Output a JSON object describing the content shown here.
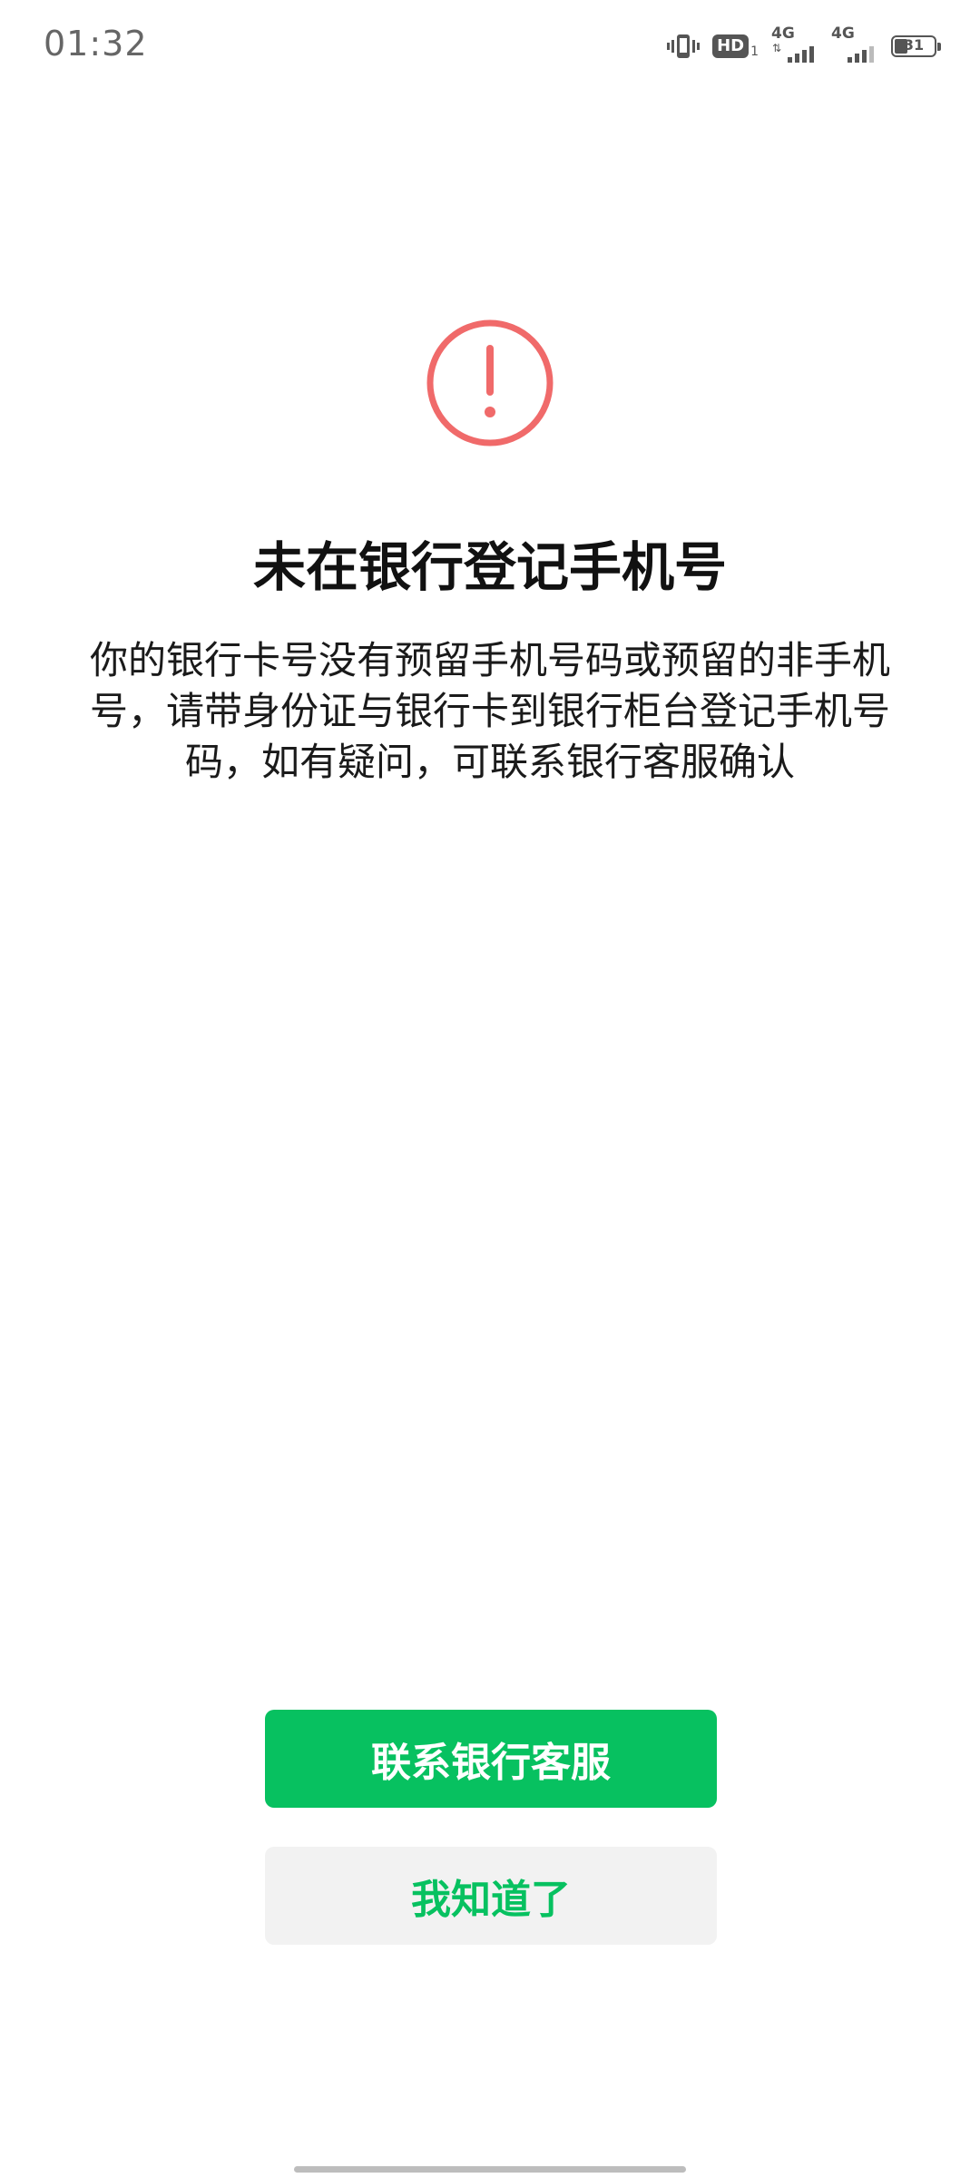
{
  "status_bar": {
    "time": "01:32",
    "hd_label": "HD",
    "hd_sub": "1",
    "sim1_label": "4G",
    "sim2_label": "4G",
    "battery_level": "31",
    "icons": [
      "vibrate-icon",
      "hd-volte-icon",
      "signal-4g-icon",
      "signal-4g-icon",
      "battery-icon"
    ]
  },
  "main": {
    "icon": "warning-circle-icon",
    "icon_color": "#f06a6a",
    "title": "未在银行登记手机号",
    "description": "你的银行卡号没有预留手机号码或预留的非手机号，请带身份证与银行卡到银行柜台登记手机号码，如有疑问，可联系银行客服确认"
  },
  "actions": {
    "primary_label": "联系银行客服",
    "secondary_label": "我知道了",
    "primary_color": "#07c160",
    "secondary_bg": "#f2f2f2"
  }
}
